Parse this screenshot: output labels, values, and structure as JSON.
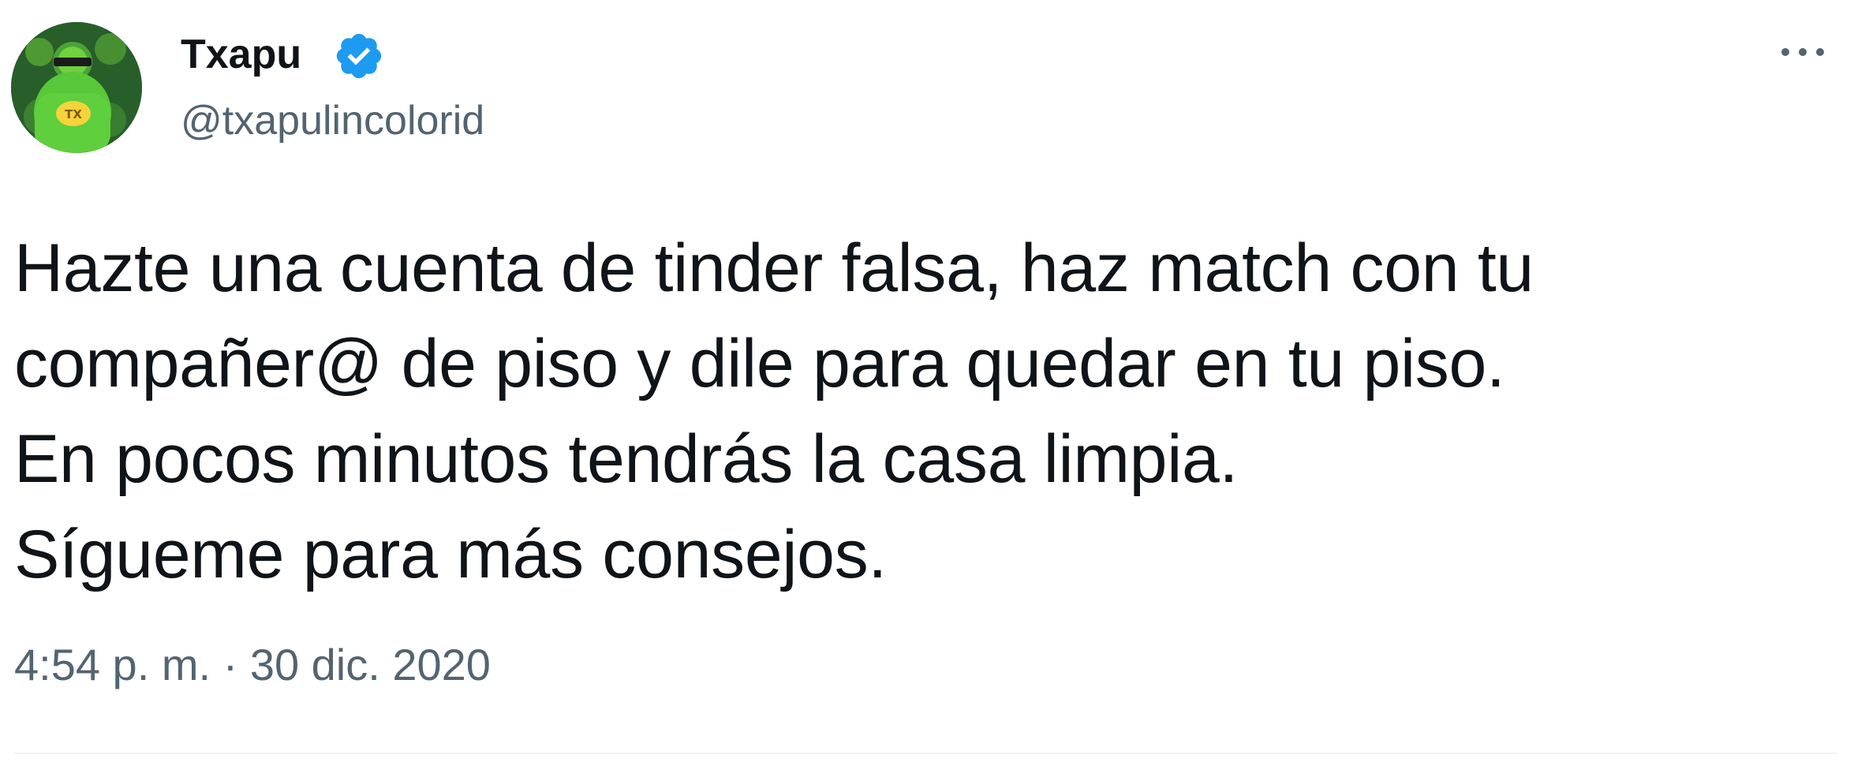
{
  "author": {
    "name": "Txapu",
    "handle": "@txapulincolorid",
    "verified": true,
    "avatar_badge_text": "TX"
  },
  "tweet": {
    "lines": [
      "Hazte una cuenta de tinder falsa, haz match con tu",
      "compañer@ de piso y dile para quedar en tu piso.",
      "En pocos minutos tendrás la casa limpia.",
      "Sígueme para más consejos."
    ]
  },
  "meta": {
    "time": "4:54 p. m.",
    "separator": "·",
    "date": "30 dic. 2020"
  },
  "icons": {
    "verified": "verified-badge-icon",
    "more": "more-options-icon"
  },
  "colors": {
    "text": "#0f1419",
    "secondary_text": "#536471",
    "verified_blue": "#1d9bf0",
    "divider": "#eff3f4",
    "avatar_green": "#63c63a"
  }
}
